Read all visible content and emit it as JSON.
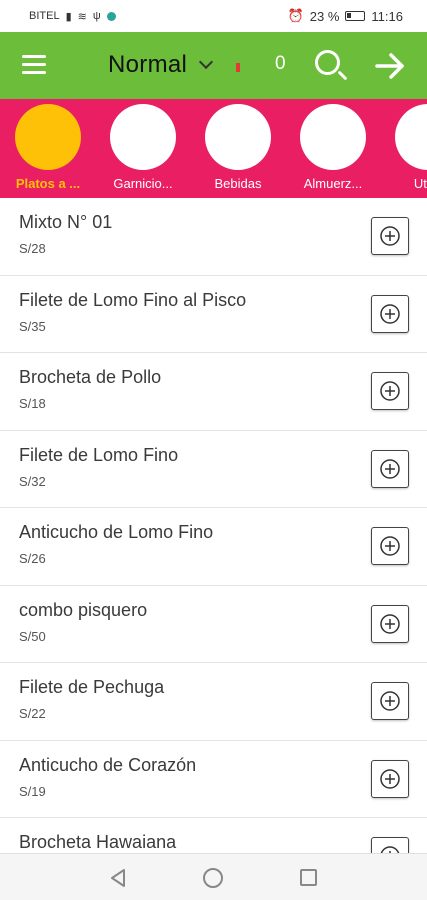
{
  "status_bar": {
    "carrier": "BITEL",
    "battery": "23 %",
    "time": "11:16"
  },
  "toolbar": {
    "mode": "Normal",
    "cart_count": "0",
    "accent_color": "#6cbd3a"
  },
  "categories": {
    "background_color": "#e91e63",
    "active_color": "#ffc107",
    "items": [
      {
        "label": "Platos a ..."
      },
      {
        "label": "Garnicio..."
      },
      {
        "label": "Bebidas"
      },
      {
        "label": "Almuerz..."
      },
      {
        "label": "Utilic"
      }
    ]
  },
  "products": [
    {
      "name": "Mixto N° 01",
      "price": "S/28"
    },
    {
      "name": "Filete de Lomo Fino al Pisco",
      "price": "S/35"
    },
    {
      "name": "Brocheta de Pollo",
      "price": "S/18"
    },
    {
      "name": "Filete de Lomo Fino",
      "price": "S/32"
    },
    {
      "name": "Anticucho de Lomo Fino",
      "price": "S/26"
    },
    {
      "name": "combo pisquero",
      "price": "S/50"
    },
    {
      "name": "Filete de Pechuga",
      "price": "S/22"
    },
    {
      "name": "Anticucho de Corazón",
      "price": "S/19"
    },
    {
      "name": "Brocheta Hawaiana",
      "price": ""
    }
  ]
}
